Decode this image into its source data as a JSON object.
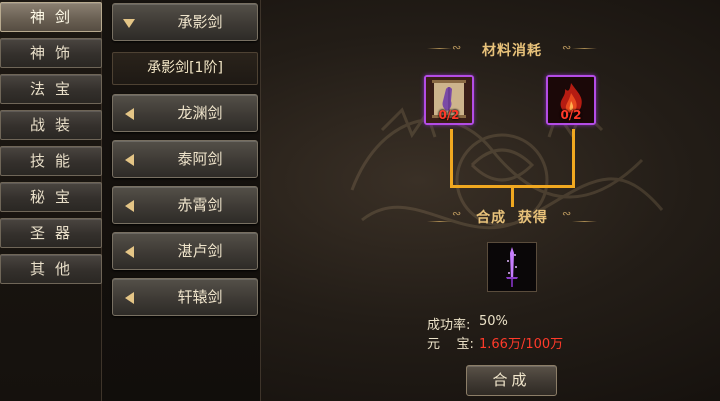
{
  "categories": [
    {
      "label": "神剑",
      "active": true
    },
    {
      "label": "神饰",
      "active": false
    },
    {
      "label": "法宝",
      "active": false
    },
    {
      "label": "战装",
      "active": false
    },
    {
      "label": "技能",
      "active": false
    },
    {
      "label": "秘宝",
      "active": false
    },
    {
      "label": "圣器",
      "active": false
    },
    {
      "label": "其他",
      "active": false
    }
  ],
  "items": [
    {
      "label": "承影剑",
      "expanded": true
    },
    {
      "label": "龙渊剑",
      "expanded": false
    },
    {
      "label": "泰阿剑",
      "expanded": false
    },
    {
      "label": "赤霄剑",
      "expanded": false
    },
    {
      "label": "湛卢剑",
      "expanded": false
    },
    {
      "label": "轩辕剑",
      "expanded": false
    }
  ],
  "selected_sub_item": "承影剑[1阶]",
  "materials_title": "材料消耗",
  "materials": [
    {
      "name": "scroll-material-icon",
      "count": "0/2"
    },
    {
      "name": "fire-material-icon",
      "count": "0/2"
    }
  ],
  "obtain_title": "合成  获得",
  "result_item": "purple-sword-icon",
  "success_rate_label": "成功率:",
  "success_rate_value": "50%",
  "yuanbao_label": "元    宝:",
  "yuanbao_value": "1.66万/100万",
  "compose_button": "合成",
  "colors": {
    "accent_gold": "#f0a820",
    "rare_purple": "#b44ce6",
    "cost_red": "#ff3a2a",
    "title_gold": "#e8c27a"
  }
}
